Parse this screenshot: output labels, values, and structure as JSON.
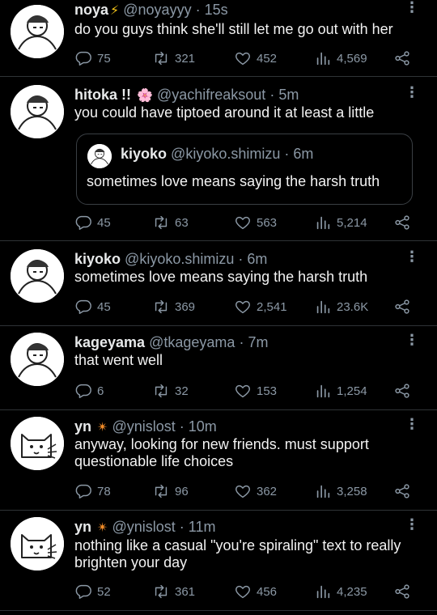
{
  "tweets": [
    {
      "name": "noya",
      "badge": "⚡",
      "handle": "@noyayyy",
      "dot": "·",
      "time": "15s",
      "text": "do you guys think she'll still let me go out with her",
      "replies": "75",
      "retweets": "321",
      "likes": "452",
      "views": "4,569"
    },
    {
      "name": "hitoka !!",
      "badge": "🌸",
      "handle": "@yachifreaksout",
      "dot": "·",
      "time": "5m",
      "text": "you could have tiptoed around it at least a little",
      "quote": {
        "name": "kiyoko",
        "handle": "@kiyoko.shimizu",
        "dot": "·",
        "time": "6m",
        "text": "sometimes love means saying the harsh truth"
      },
      "replies": "45",
      "retweets": "63",
      "likes": "563",
      "views": "5,214"
    },
    {
      "name": "kiyoko",
      "handle": "@kiyoko.shimizu",
      "dot": "·",
      "time": "6m",
      "text": "sometimes love means saying the harsh truth",
      "replies": "45",
      "retweets": "369",
      "likes": "2,541",
      "views": "23.6K"
    },
    {
      "name": "kageyama",
      "handle": "@tkageyama",
      "dot": "·",
      "time": "7m",
      "text": "that went well",
      "replies": "6",
      "retweets": "32",
      "likes": "153",
      "views": "1,254"
    },
    {
      "name": "yn",
      "badge": "✴",
      "handle": "@ynislost",
      "dot": "·",
      "time": "10m",
      "text_line1": "anyway, looking for new friends. must support",
      "text_line2": "questionable life choices",
      "replies": "78",
      "retweets": "96",
      "likes": "362",
      "views": "3,258"
    },
    {
      "name": "yn",
      "badge": "✴",
      "handle": "@ynislost",
      "dot": "·",
      "time": "11m",
      "text_line1": "nothing like a casual \"you're spiraling\" text to really",
      "text_line2": "brighten your day",
      "replies": "52",
      "retweets": "361",
      "likes": "456",
      "views": "4,235"
    }
  ],
  "more_glyph": "⋮"
}
